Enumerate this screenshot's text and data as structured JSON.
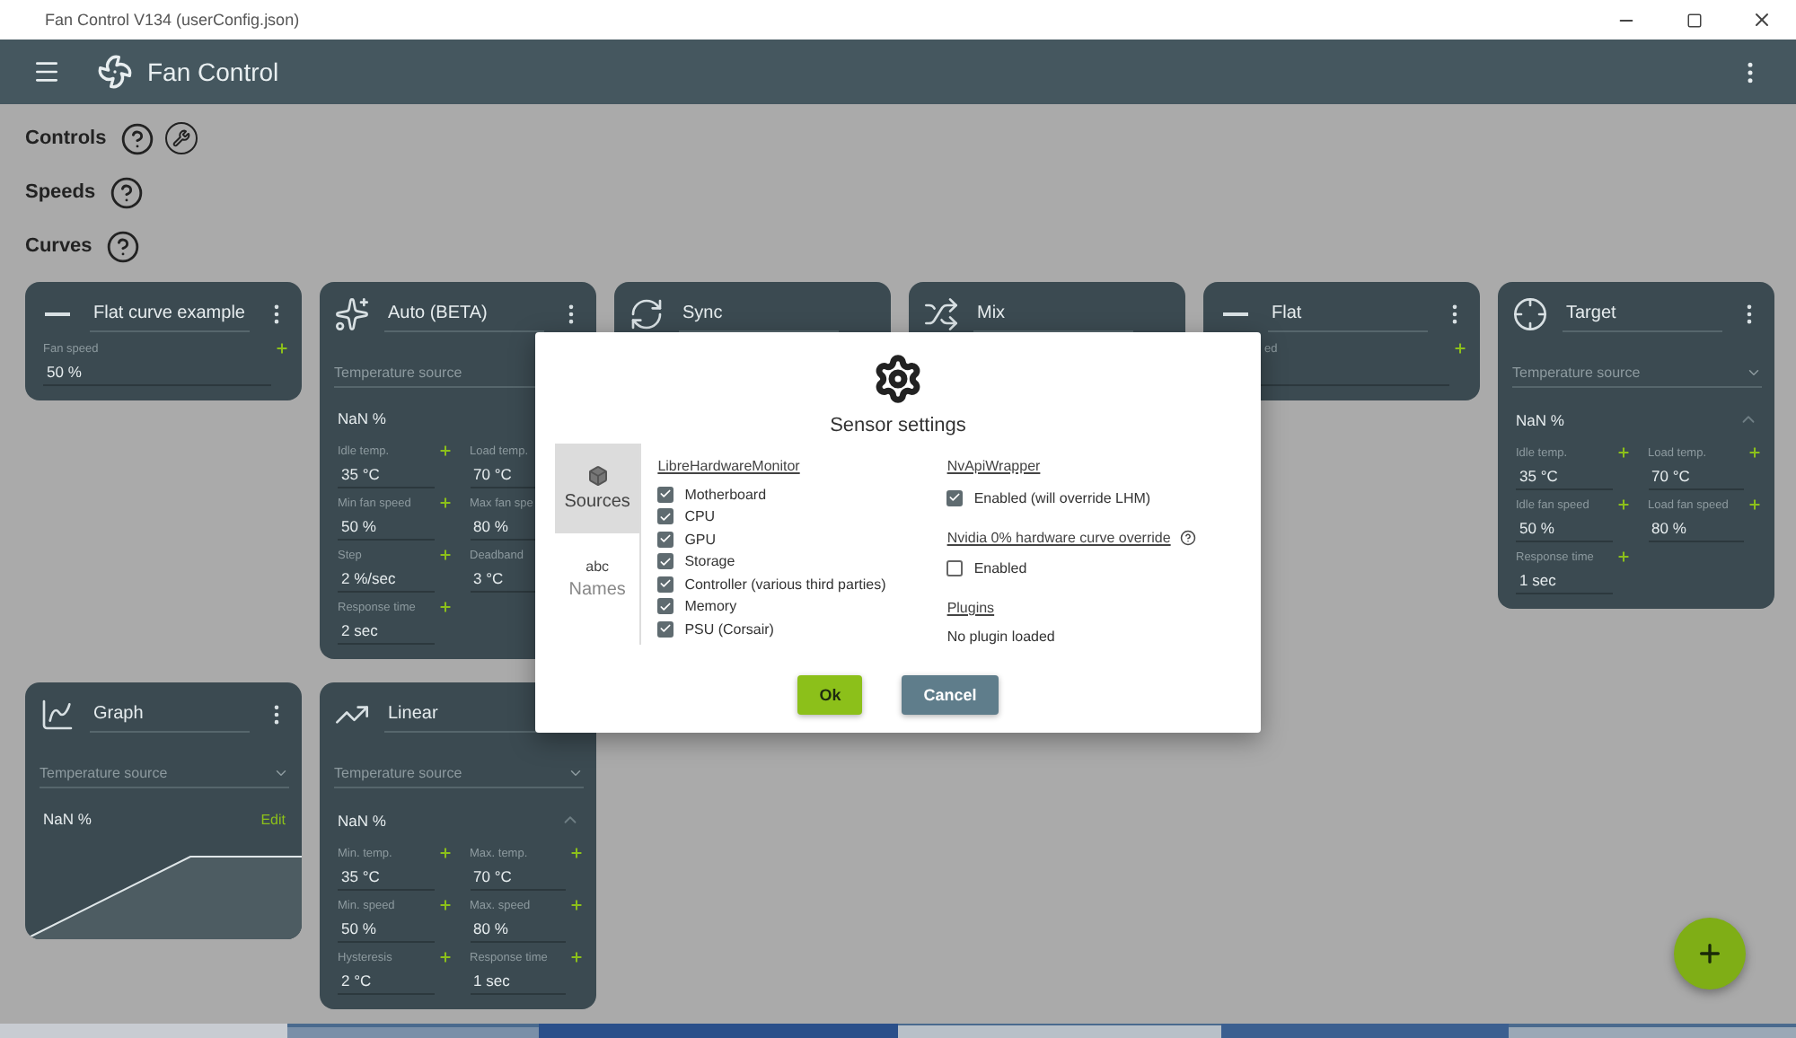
{
  "title_bar": {
    "title": "Fan Control V134 (userConfig.json)"
  },
  "app_bar": {
    "title": "Fan Control"
  },
  "sections": [
    {
      "kind": "controls",
      "label": "Controls"
    },
    {
      "kind": "plain",
      "label": "Speeds"
    },
    {
      "kind": "plain",
      "label": "Curves"
    }
  ],
  "cards": [
    {
      "kind": "flat",
      "title": "Flat curve example",
      "menu": true,
      "fields": [
        {
          "kind": "full",
          "label": "Fan speed",
          "value": "50 %"
        }
      ]
    },
    {
      "kind": "auto",
      "title": "Auto (BETA)",
      "menu": true,
      "source": "Temperature source",
      "reading": "NaN %",
      "fields": [
        {
          "kind": "field",
          "label": "Idle temp.",
          "value": "35 °C"
        },
        {
          "kind": "covered",
          "label": "Load temp.",
          "value": "70 °C"
        },
        {
          "kind": "field",
          "label": "Min fan speed",
          "value": "50 %"
        },
        {
          "kind": "covered",
          "label": "Max fan spe",
          "value": "80 %"
        },
        {
          "kind": "field",
          "label": "Step",
          "value": "2 %/sec"
        },
        {
          "kind": "covered",
          "label": "Deadband",
          "value": "3 °C"
        },
        {
          "kind": "field",
          "label": "Response time",
          "value": "2 sec"
        }
      ]
    },
    {
      "kind": "sync",
      "title": "Sync",
      "menu": false
    },
    {
      "kind": "mix",
      "title": "Mix",
      "menu": false
    },
    {
      "kind": "flat",
      "title": "Flat",
      "menu": true,
      "fields": [
        {
          "kind": "clipped",
          "label": "ed"
        }
      ]
    },
    {
      "kind": "target",
      "title": "Target",
      "menu": true,
      "source": "Temperature source",
      "reading": "NaN %",
      "fields": [
        {
          "kind": "field",
          "label": "Idle temp.",
          "value": "35 °C"
        },
        {
          "kind": "field",
          "label": "Load temp.",
          "value": "70 °C"
        },
        {
          "kind": "field",
          "label": "Idle fan speed",
          "value": "50 %"
        },
        {
          "kind": "field",
          "label": "Load fan speed",
          "value": "80 %"
        },
        {
          "kind": "field",
          "label": "Response time",
          "value": "1 sec"
        }
      ]
    },
    {
      "kind": "graph",
      "title": "Graph",
      "menu": true,
      "source": "Temperature source",
      "reading": "NaN %",
      "edit": "Edit"
    },
    {
      "kind": "linear",
      "title": "Linear",
      "menu": false,
      "source": "Temperature source",
      "reading": "NaN %",
      "fields": [
        {
          "kind": "field",
          "label": "Min. temp.",
          "value": "35 °C"
        },
        {
          "kind": "field",
          "label": "Max. temp.",
          "value": "70 °C"
        },
        {
          "kind": "field",
          "label": "Min. speed",
          "value": "50 %"
        },
        {
          "kind": "field",
          "label": "Max. speed",
          "value": "80 %"
        },
        {
          "kind": "field",
          "label": "Hysteresis",
          "value": "2 °C"
        },
        {
          "kind": "field",
          "label": "Response time",
          "value": "1 sec"
        }
      ]
    }
  ],
  "dialog": {
    "title": "Sensor settings",
    "tabs": [
      {
        "kind": "sources",
        "label": "Sources",
        "selected": true
      },
      {
        "kind": "names",
        "icon_text": "abc",
        "label": "Names",
        "selected": false
      }
    ],
    "left": {
      "heading": "LibreHardwareMonitor",
      "options": [
        {
          "label": "Motherboard",
          "checked": true
        },
        {
          "label": "CPU",
          "checked": true
        },
        {
          "label": "GPU",
          "checked": true
        },
        {
          "label": "Storage",
          "checked": true
        },
        {
          "label": "Controller (various third parties)",
          "checked": true
        },
        {
          "label": "Memory",
          "checked": true
        },
        {
          "label": "PSU (Corsair)",
          "checked": true
        }
      ]
    },
    "right": [
      {
        "kind": "heading",
        "text": "NvApiWrapper"
      },
      {
        "kind": "checkbox",
        "text": "Enabled (will override LHM)",
        "checked": true
      },
      {
        "kind": "heading",
        "text": "Nvidia 0% hardware curve override",
        "help": true
      },
      {
        "kind": "checkbox",
        "text": "Enabled",
        "checked": false
      },
      {
        "kind": "heading",
        "text": "Plugins"
      },
      {
        "kind": "note",
        "text": "No plugin loaded"
      }
    ],
    "buttons": [
      {
        "kind": "primary",
        "label": "Ok"
      },
      {
        "kind": "secondary",
        "label": "Cancel"
      }
    ]
  }
}
